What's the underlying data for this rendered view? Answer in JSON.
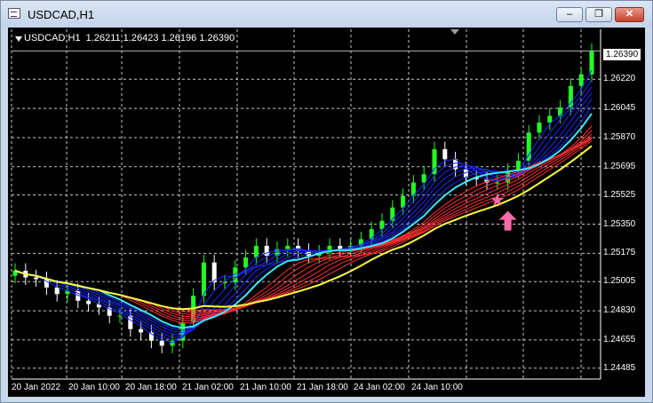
{
  "window": {
    "title": "USDCAD,H1",
    "controls": {
      "minimize": "‒",
      "restore": "❐",
      "close": "✕"
    }
  },
  "chart": {
    "info_line": "USDCAD,H1  1.26211 1.26423 1.26196 1.26390",
    "current_price": "1.26390",
    "colors": {
      "background": "#000000",
      "grid": "#c8c8c8",
      "bull_candle": "#22ff22",
      "bear_candle": "#ffffff",
      "ma_fast": "#3f9bff",
      "ma_cyan": "#3fe6ff",
      "ma_red": "#ff3030",
      "ma_yellow": "#ffff40",
      "ma_blue_band": "#1a2cff",
      "signal_star": "#ff6aa8",
      "signal_arrow": "#ff6aa8"
    }
  },
  "chart_data": {
    "type": "line",
    "symbol": "USDCAD",
    "timeframe": "H1",
    "ylim": [
      1.2442,
      1.2652
    ],
    "yticks": [
      "1.26220",
      "1.26045",
      "1.25870",
      "1.25695",
      "1.25525",
      "1.25350",
      "1.25175",
      "1.25005",
      "1.24830",
      "1.24655",
      "1.24485"
    ],
    "xticks": [
      "20 Jan 2022",
      "20 Jan 10:00",
      "20 Jan 18:00",
      "21 Jan 02:00",
      "21 Jan 10:00",
      "21 Jan 18:00",
      "24 Jan 02:00",
      "24 Jan 10:00"
    ],
    "grid": true,
    "series": [
      {
        "values": [
          1.2507,
          1.2503,
          1.2502,
          1.2497,
          1.2493,
          1.2495,
          1.2489,
          1.2487,
          1.2485,
          1.248,
          1.248,
          1.2472,
          1.247,
          1.2465,
          1.2462,
          1.2465,
          1.2476,
          1.2492,
          1.2512,
          1.25,
          1.25,
          1.2509,
          1.2515,
          1.2522,
          1.2516,
          1.252,
          1.2522,
          1.2519,
          1.2516,
          1.2518,
          1.2522,
          1.252,
          1.2522,
          1.2526,
          1.2532,
          1.2537,
          1.2545,
          1.2552,
          1.256,
          1.2565,
          1.258,
          1.2574,
          1.2568,
          1.2563,
          1.2562,
          1.256,
          1.256,
          1.2567,
          1.2573,
          1.259,
          1.2596,
          1.26,
          1.2605,
          1.2618,
          1.2625,
          1.2639
        ]
      }
    ]
  }
}
